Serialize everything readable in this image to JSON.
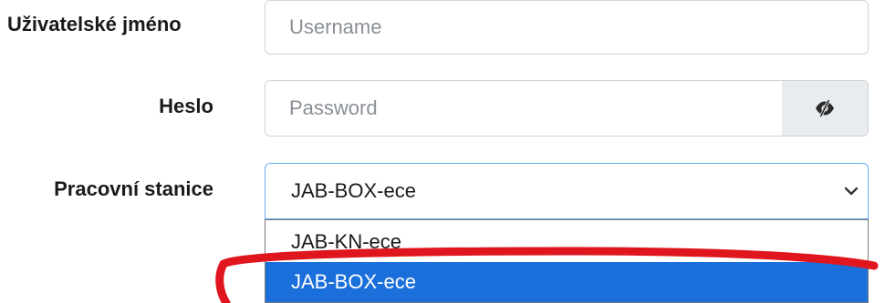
{
  "form": {
    "username": {
      "label": "Uživatelské jméno",
      "placeholder": "Username",
      "value": ""
    },
    "password": {
      "label": "Heslo",
      "placeholder": "Password",
      "value": "",
      "toggle_icon": "eye-slash-icon"
    },
    "workstation": {
      "label": "Pracovní stanice",
      "selected": "JAB-BOX-ece",
      "chevron_icon": "chevron-down-icon",
      "options": [
        "JAB-KN-ece",
        "JAB-BOX-ece"
      ],
      "highlighted_index": 1
    }
  },
  "colors": {
    "highlight": "#1a6fdb",
    "focus_border": "#6aa8f7",
    "annotation": "#e0161e"
  }
}
